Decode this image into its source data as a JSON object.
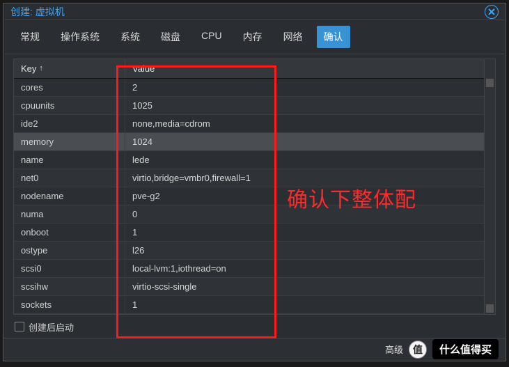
{
  "window": {
    "title": "创建: 虚拟机"
  },
  "tabs": {
    "items": [
      {
        "label": "常规"
      },
      {
        "label": "操作系统"
      },
      {
        "label": "系统"
      },
      {
        "label": "磁盘"
      },
      {
        "label": "CPU"
      },
      {
        "label": "内存"
      },
      {
        "label": "网络"
      },
      {
        "label": "确认"
      }
    ],
    "activeIndex": 7
  },
  "table": {
    "header": {
      "key": "Key",
      "sort_arrow": "↑",
      "value": "Value"
    },
    "selectedIndex": 3,
    "rows": [
      {
        "key": "cores",
        "value": "2"
      },
      {
        "key": "cpuunits",
        "value": "1025"
      },
      {
        "key": "ide2",
        "value": "none,media=cdrom"
      },
      {
        "key": "memory",
        "value": "1024"
      },
      {
        "key": "name",
        "value": "lede"
      },
      {
        "key": "net0",
        "value": "virtio,bridge=vmbr0,firewall=1"
      },
      {
        "key": "nodename",
        "value": "pve-g2"
      },
      {
        "key": "numa",
        "value": "0"
      },
      {
        "key": "onboot",
        "value": "1"
      },
      {
        "key": "ostype",
        "value": "l26"
      },
      {
        "key": "scsi0",
        "value": "local-lvm:1,iothread=on"
      },
      {
        "key": "scsihw",
        "value": "virtio-scsi-single"
      },
      {
        "key": "sockets",
        "value": "1"
      }
    ]
  },
  "startAfterCreate": {
    "label": "创建后启动",
    "checked": false
  },
  "footer": {
    "advanced_label": "高级",
    "badge_text": "值",
    "brand_text": "什么值得买"
  },
  "annotation": {
    "text": "确认下整体配"
  }
}
